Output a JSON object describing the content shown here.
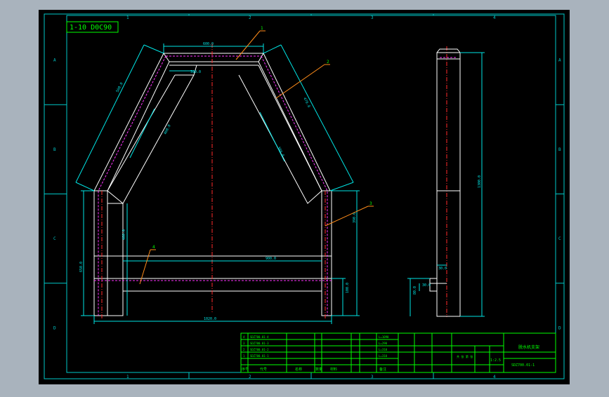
{
  "colors": {
    "background": "#a9b3bd",
    "sheet": "#000000",
    "frame": "#00c8c8",
    "geometry": "#ffffff",
    "dimension": "#00e5e5",
    "hidden_line": "#ff33ff",
    "centerline": "#ff2a2a",
    "leader": "#ff8c1a",
    "text": "#00ff00"
  },
  "drawing_code": "1-10 D0C90",
  "zone_columns": [
    "1",
    "2",
    "3",
    "4"
  ],
  "zone_rows": [
    "A",
    "B",
    "C",
    "D"
  ],
  "part_callouts": [
    "1",
    "2",
    "3",
    "4"
  ],
  "dimensions": {
    "top_width": "600.0",
    "inner_top_width": "390.0",
    "left_outer_slant": "560.0",
    "left_inner_slant": "460.0",
    "right_slant": "470.0",
    "right_inner_slant": "380.0",
    "left_leg_height": "400.0",
    "left_leg_total": "650.0",
    "right_leg_height": "390.0",
    "crossbar_length": "900.0",
    "bottom_leg_height": "100.0",
    "overall_width": "1020.0",
    "side_height": "1300.0",
    "side_lower": "80.0",
    "side_foot": "30.0"
  },
  "bom_rows": [
    {
      "no": "4",
      "code": "SDZ700.01-4",
      "material": "L=1090"
    },
    {
      "no": "3",
      "code": "SDZ700.01-3",
      "material": "L=290"
    },
    {
      "no": "2",
      "code": "SDZ700.01-2",
      "material": "L=310"
    },
    {
      "no": "1",
      "code": "SDZ700.01-1",
      "material": "L=310"
    }
  ],
  "bom_header": [
    "序号",
    "代号",
    "名称",
    "数量",
    "材料",
    "备注"
  ],
  "title_block": {
    "title": "脱水机支架",
    "code": "SDZ700.01-1",
    "scale": "1:2.5",
    "sheet_label": "共 张 第 张"
  }
}
